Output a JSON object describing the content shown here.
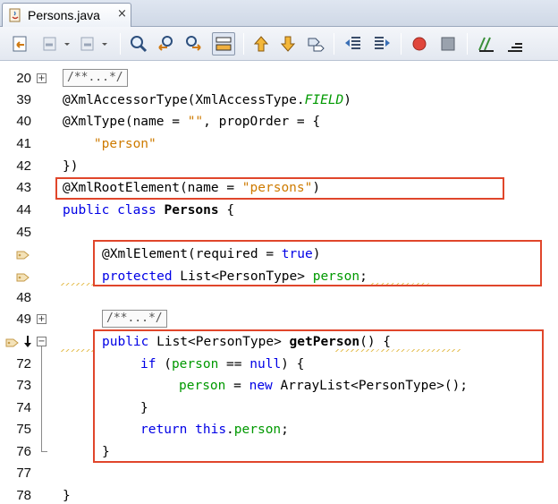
{
  "tab": {
    "title": "Persons.java",
    "close_glyph": "×"
  },
  "toolbar": {
    "buttons": [
      "last-edit-icon",
      "back-icon",
      "back-dropdown-icon",
      "forward-icon",
      "forward-dropdown-icon",
      "find-selection-icon",
      "find-previous-icon",
      "find-next-icon",
      "toggle-highlight-icon",
      "previous-bookmark-icon",
      "next-bookmark-icon",
      "toggle-bookmark-icon",
      "shift-left-icon",
      "shift-right-icon",
      "start-macro-icon",
      "stop-macro-icon",
      "comment-icon",
      "uncomment-icon"
    ]
  },
  "colors": {
    "keyword": "#0000e6",
    "string": "#ce7b00",
    "field": "#009900",
    "highlight_box": "#e0462b"
  },
  "editor": {
    "lines": {
      "l20": {
        "num": "20",
        "fold": "+",
        "collapsed": "/**...*/"
      },
      "l39": {
        "num": "39",
        "a": "@XmlAccessorType(XmlAccessType.",
        "b": "FIELD",
        "c": ")"
      },
      "l40": {
        "num": "40",
        "a": "@XmlType(name = ",
        "b": "\"\"",
        "c": ", propOrder = {"
      },
      "l41": {
        "num": "41",
        "a": "    ",
        "b": "\"person\""
      },
      "l42": {
        "num": "42",
        "a": "})"
      },
      "l43": {
        "num": "43",
        "a": "@XmlRootElement(name = ",
        "b": "\"persons\"",
        "c": ")"
      },
      "l44": {
        "num": "44",
        "kw1": "public",
        "kw2": "class",
        "name": "Persons",
        "rest": " {"
      },
      "l45": {
        "num": "45"
      },
      "l46": {
        "a": "@XmlElement(required = ",
        "kw": "true",
        "c": ")"
      },
      "l47": {
        "kw": "protected",
        "mid": " List<PersonType> ",
        "fld": "person",
        "end": ";"
      },
      "l48": {
        "num": "48"
      },
      "l49": {
        "num": "49",
        "fold": "+",
        "collapsed": "/**...*/"
      },
      "l71": {
        "fold": "−",
        "kw": "public",
        "mid": " List<PersonType> ",
        "name": "getPerson",
        "end": "() {"
      },
      "l72": {
        "num": "72",
        "kw": "if",
        "a": " (",
        "fld": "person",
        "b": " == ",
        "kw2": "null",
        "c": ") {"
      },
      "l73": {
        "num": "73",
        "fld": "person",
        "a": " = ",
        "kw": "new",
        "b": " ArrayList<PersonType>();"
      },
      "l74": {
        "num": "74",
        "a": "}"
      },
      "l75": {
        "num": "75",
        "kw": "return",
        "sp": " ",
        "kw2": "this",
        "dot": ".",
        "fld": "person",
        "end": ";"
      },
      "l76": {
        "num": "76",
        "a": "}"
      },
      "l77": {
        "num": "77"
      },
      "l78": {
        "num": "78",
        "a": "}"
      }
    }
  }
}
